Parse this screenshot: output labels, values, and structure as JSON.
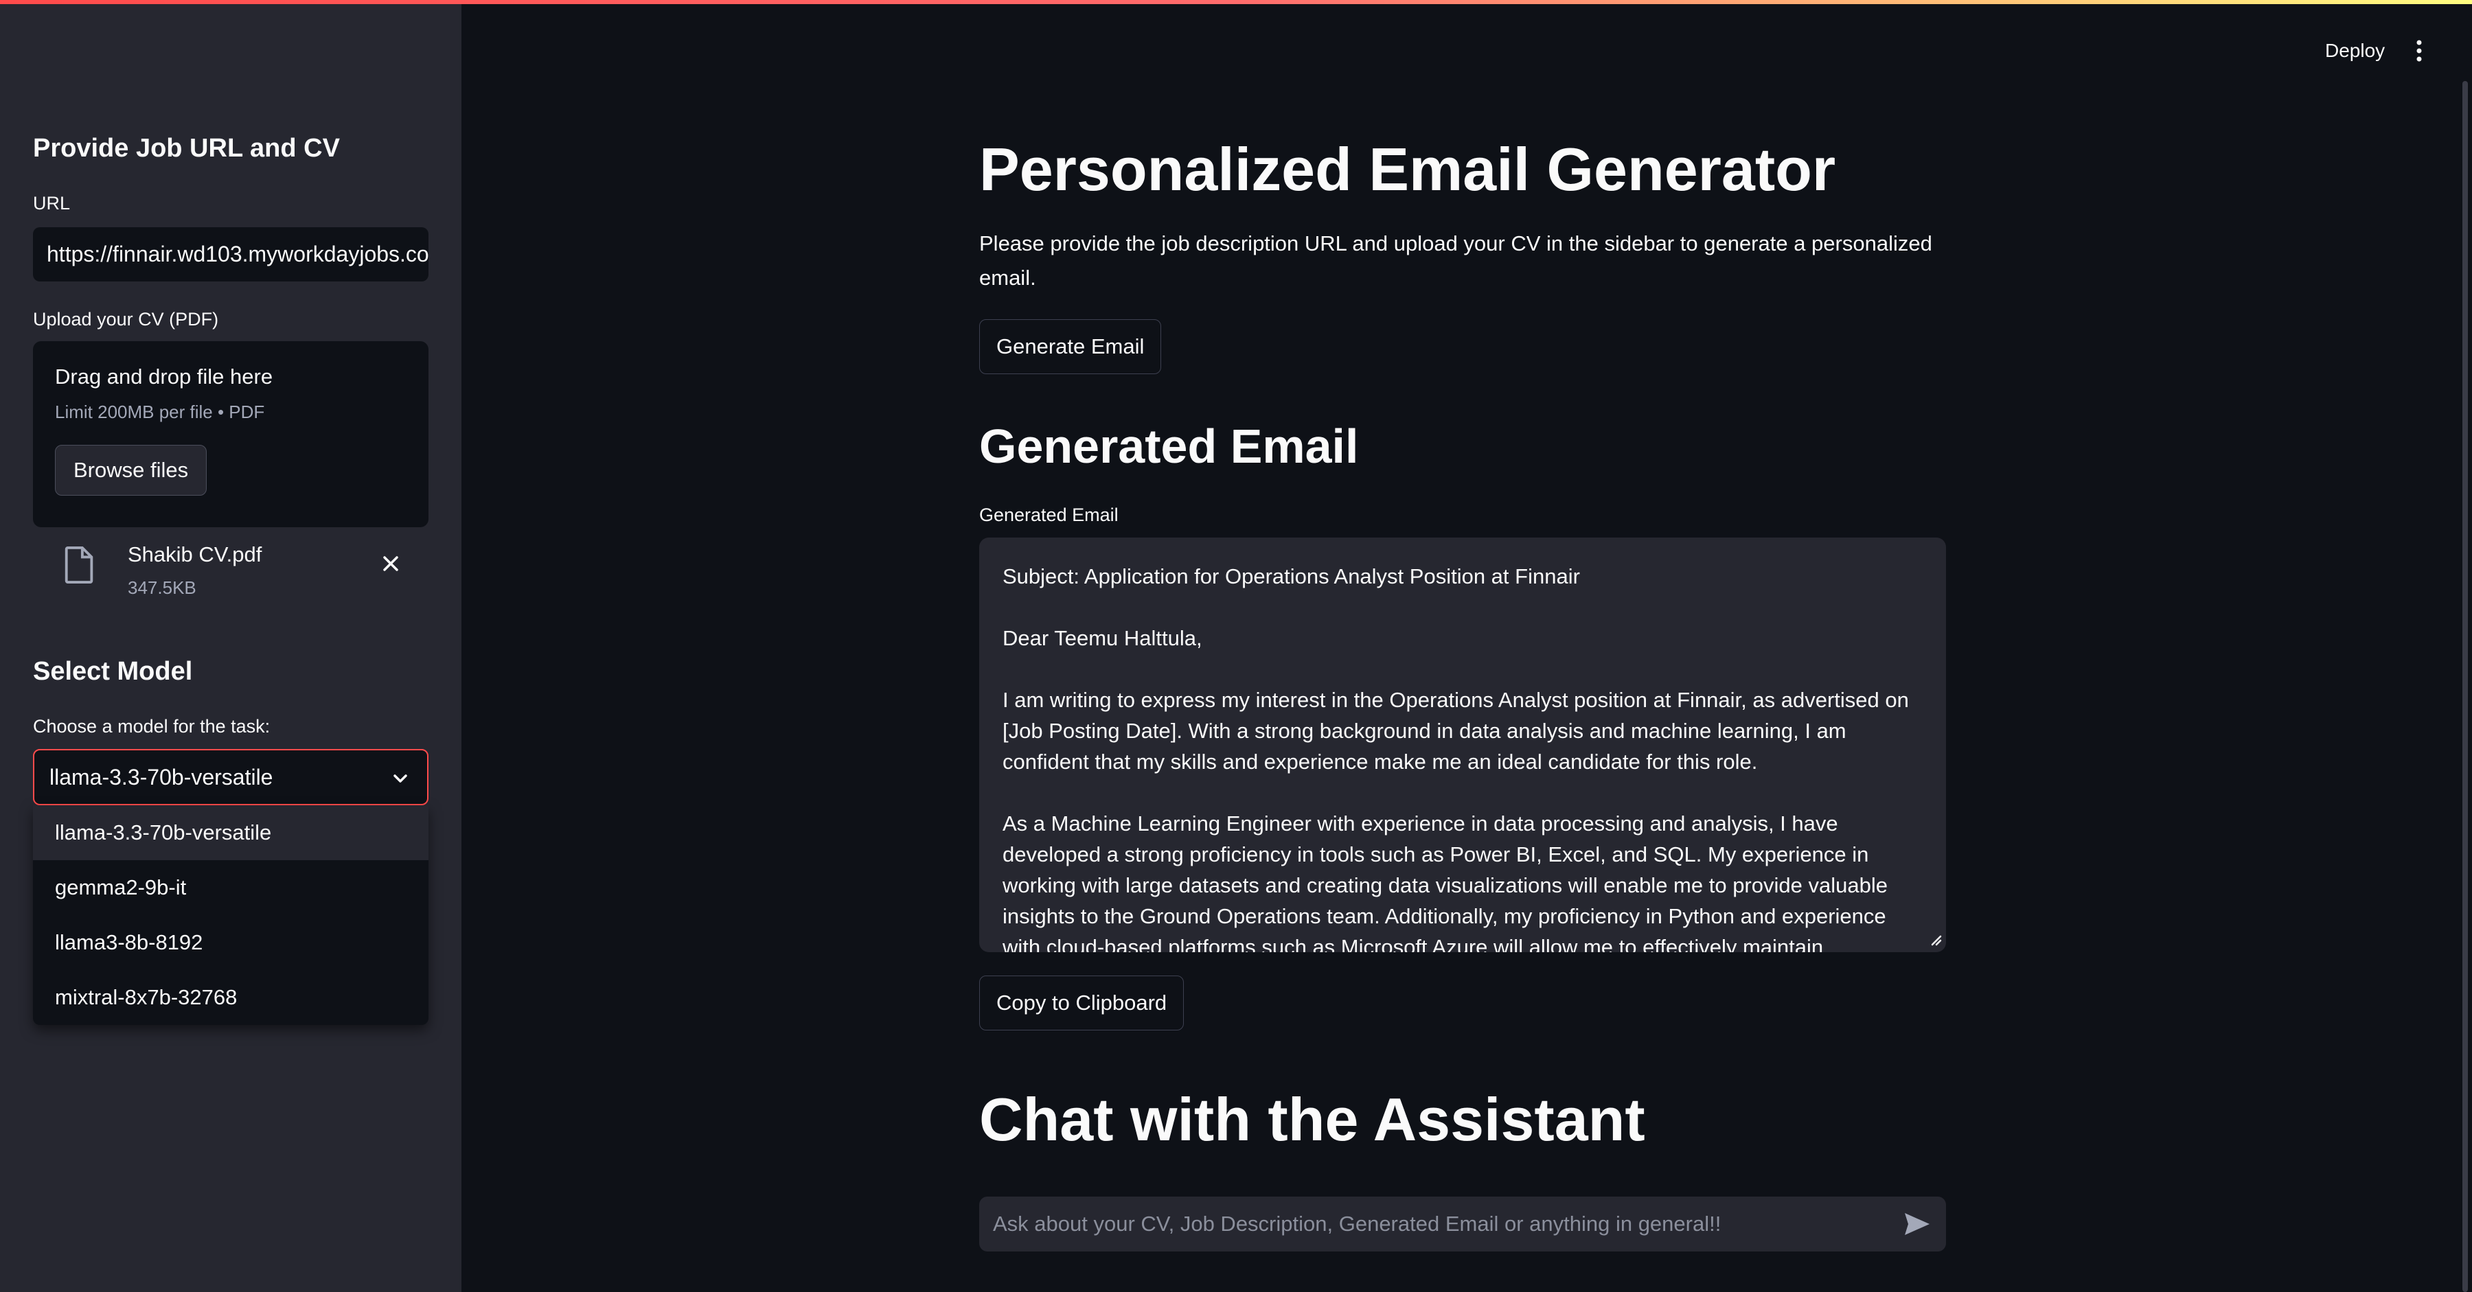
{
  "sidebar": {
    "heading": "Provide Job URL and CV",
    "url_label": "URL",
    "url_value": "https://finnair.wd103.myworkdayjobs.co",
    "upload_label": "Upload your CV (PDF)",
    "upload": {
      "dropzone_text": "Drag and drop file here",
      "limit_text": "Limit 200MB per file • PDF",
      "browse_label": "Browse files"
    },
    "file": {
      "name": "Shakib CV.pdf",
      "size": "347.5KB"
    },
    "model_heading": "Select Model",
    "model_label": "Choose a model for the task:",
    "model_selected": "llama-3.3-70b-versatile",
    "model_options": [
      "llama-3.3-70b-versatile",
      "gemma2-9b-it",
      "llama3-8b-8192",
      "mixtral-8x7b-32768"
    ]
  },
  "header": {
    "deploy_label": "Deploy"
  },
  "main": {
    "title": "Personalized Email Generator",
    "intro": "Please provide the job description URL and upload your CV in the sidebar to generate a personalized email.",
    "generate_label": "Generate Email",
    "generated_heading": "Generated Email",
    "generated_field_label": "Generated Email",
    "email": {
      "subject": "Subject: Application for Operations Analyst Position at Finnair",
      "greeting": "Dear Teemu Halttula,",
      "para1": "I am writing to express my interest in the Operations Analyst position at Finnair, as advertised on [Job Posting Date]. With a strong background in data analysis and machine learning, I am confident that my skills and experience make me an ideal candidate for this role.",
      "para2": "As a Machine Learning Engineer with experience in data processing and analysis, I have developed a strong proficiency in tools such as Power BI, Excel, and SQL. My experience in working with large datasets and creating data visualizations will enable me to provide valuable insights to the Ground Operations team. Additionally, my proficiency in Python and experience with cloud-based platforms such as Microsoft Azure will allow me to effectively maintain production planning data and analysis."
    },
    "copy_label": "Copy to Clipboard",
    "chat_heading": "Chat with the Assistant",
    "chat_placeholder": "Ask about your CV, Job Description, Generated Email or anything in general!!"
  },
  "colors": {
    "accent": "#ff4b4b",
    "background": "#0e1117",
    "sidebar": "#262730"
  }
}
